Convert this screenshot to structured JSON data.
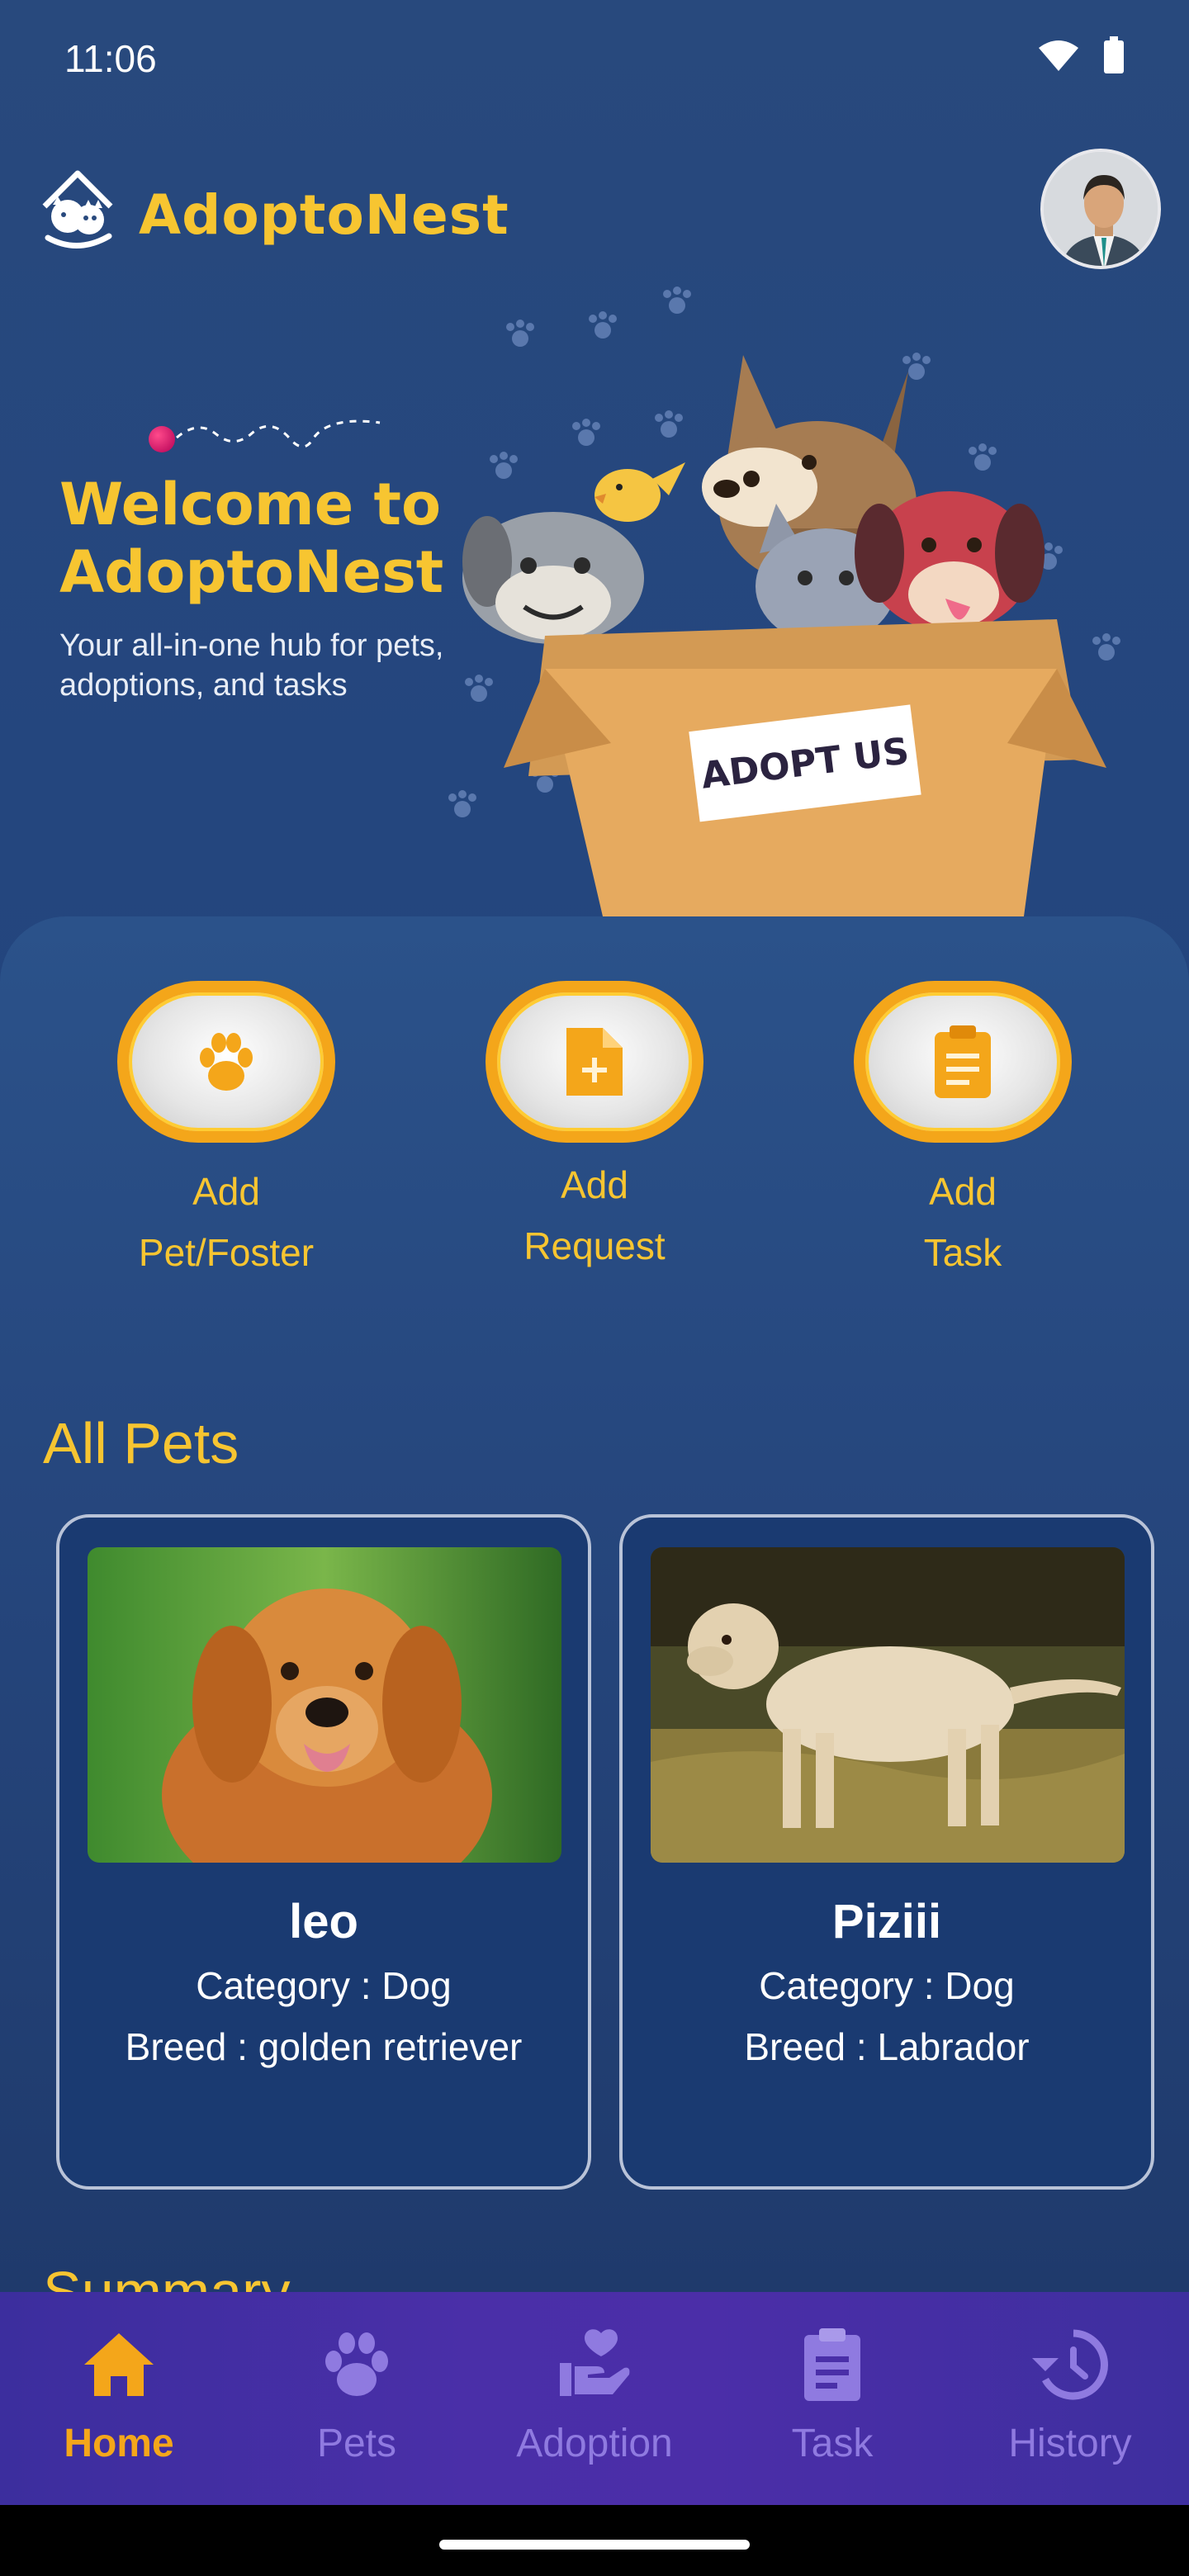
{
  "status_bar": {
    "time": "11:06"
  },
  "header": {
    "brand": "AdoptoNest",
    "logo_icon": "house-cat-dog-icon",
    "avatar_icon": "user-avatar"
  },
  "hero": {
    "title_line1": "Welcome to",
    "title_line2": "AdoptoNest",
    "subtitle": "Your all-in-one hub for pets, adoptions, and tasks",
    "box_sign": "ADOPT US"
  },
  "actions": [
    {
      "line1": "Add",
      "line2": "Pet/Foster",
      "icon": "paw-icon"
    },
    {
      "line1": "Add",
      "line2": "Request",
      "icon": "file-plus-icon"
    },
    {
      "line1": "Add",
      "line2": "Task",
      "icon": "clipboard-icon"
    }
  ],
  "all_pets": {
    "title": "All Pets",
    "pets": [
      {
        "name": "leo",
        "category": "Category : Dog",
        "breed": "Breed : golden retriever"
      },
      {
        "name": "Piziii",
        "category": "Category : Dog",
        "breed": "Breed : Labrador"
      }
    ]
  },
  "summary": {
    "title": "Summary"
  },
  "bottom_nav": {
    "items": [
      {
        "label": "Home",
        "icon": "home-icon",
        "active": true
      },
      {
        "label": "Pets",
        "icon": "paw-icon",
        "active": false
      },
      {
        "label": "Adoption",
        "icon": "hand-heart-icon",
        "active": false
      },
      {
        "label": "Task",
        "icon": "clipboard-list-icon",
        "active": false
      },
      {
        "label": "History",
        "icon": "history-icon",
        "active": false
      }
    ]
  },
  "colors": {
    "accent": "#f7c531",
    "orange": "#f4a61a",
    "nav_inactive": "#8f7ae0",
    "card_bg": "#1a3a71"
  }
}
